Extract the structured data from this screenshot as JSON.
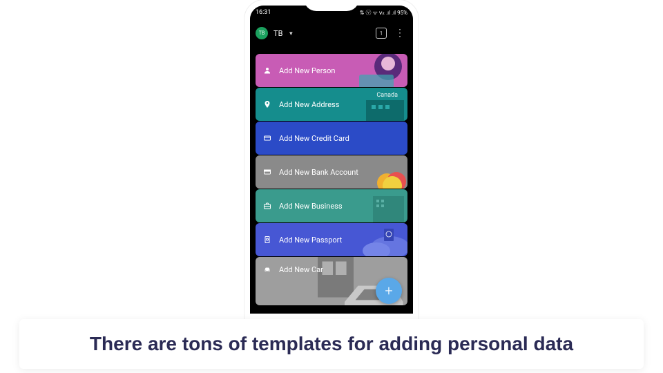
{
  "status": {
    "time": "16:31",
    "battery": "95%",
    "signal_text": "⇅ ⓥ ᯤ 𝗏ᵢₜ .ıl .ıl"
  },
  "appbar": {
    "avatar_initials": "TB",
    "account_label": "TB",
    "tab_count": "1"
  },
  "cards": {
    "person": {
      "label": "Add New Person"
    },
    "address": {
      "label": "Add New Address",
      "badge": "Canada"
    },
    "credit": {
      "label": "Add New Credit Card"
    },
    "bank": {
      "label": "Add New Bank Account"
    },
    "business": {
      "label": "Add New Business"
    },
    "passport": {
      "label": "Add New Passport"
    },
    "car": {
      "label": "Add New Car"
    }
  },
  "fab": {
    "glyph": "+"
  },
  "caption": "There are tons of templates for adding personal data",
  "colors": {
    "person": "#c85cb5",
    "address": "#158d8d",
    "credit": "#2b4bc7",
    "bank": "#8a8a8a",
    "business": "#3a9b8d",
    "passport": "#4757d4",
    "car": "#9e9e9e",
    "fab": "#5aa8e8",
    "avatar": "#1ba05e"
  }
}
